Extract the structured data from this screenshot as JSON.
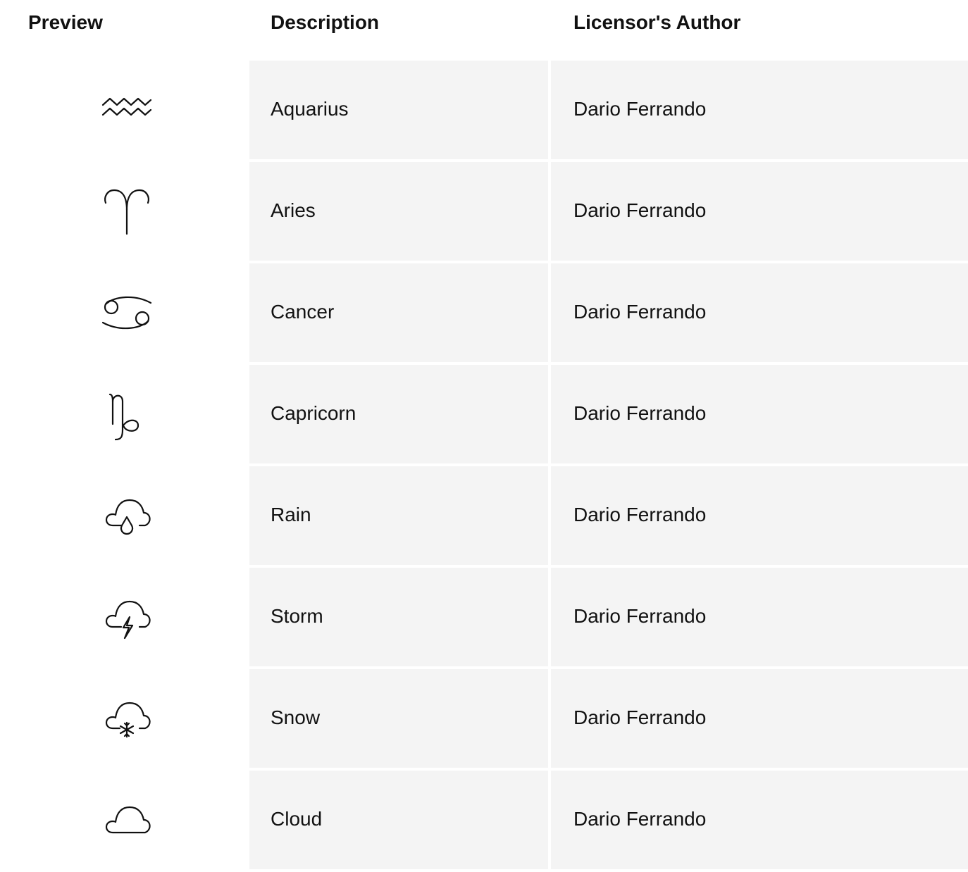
{
  "table": {
    "columns": {
      "preview": "Preview",
      "description": "Description",
      "author": "Licensor's Author"
    },
    "rows": [
      {
        "icon": "aquarius-icon",
        "description": "Aquarius",
        "author": "Dario Ferrando"
      },
      {
        "icon": "aries-icon",
        "description": "Aries",
        "author": "Dario Ferrando"
      },
      {
        "icon": "cancer-icon",
        "description": "Cancer",
        "author": "Dario Ferrando"
      },
      {
        "icon": "capricorn-icon",
        "description": "Capricorn",
        "author": "Dario Ferrando"
      },
      {
        "icon": "rain-icon",
        "description": "Rain",
        "author": "Dario Ferrando"
      },
      {
        "icon": "storm-icon",
        "description": "Storm",
        "author": "Dario Ferrando"
      },
      {
        "icon": "snow-icon",
        "description": "Snow",
        "author": "Dario Ferrando"
      },
      {
        "icon": "cloud-icon",
        "description": "Cloud",
        "author": "Dario Ferrando"
      }
    ]
  },
  "colors": {
    "cell_background": "#f4f4f4",
    "text": "#111111",
    "page_background": "#ffffff"
  }
}
